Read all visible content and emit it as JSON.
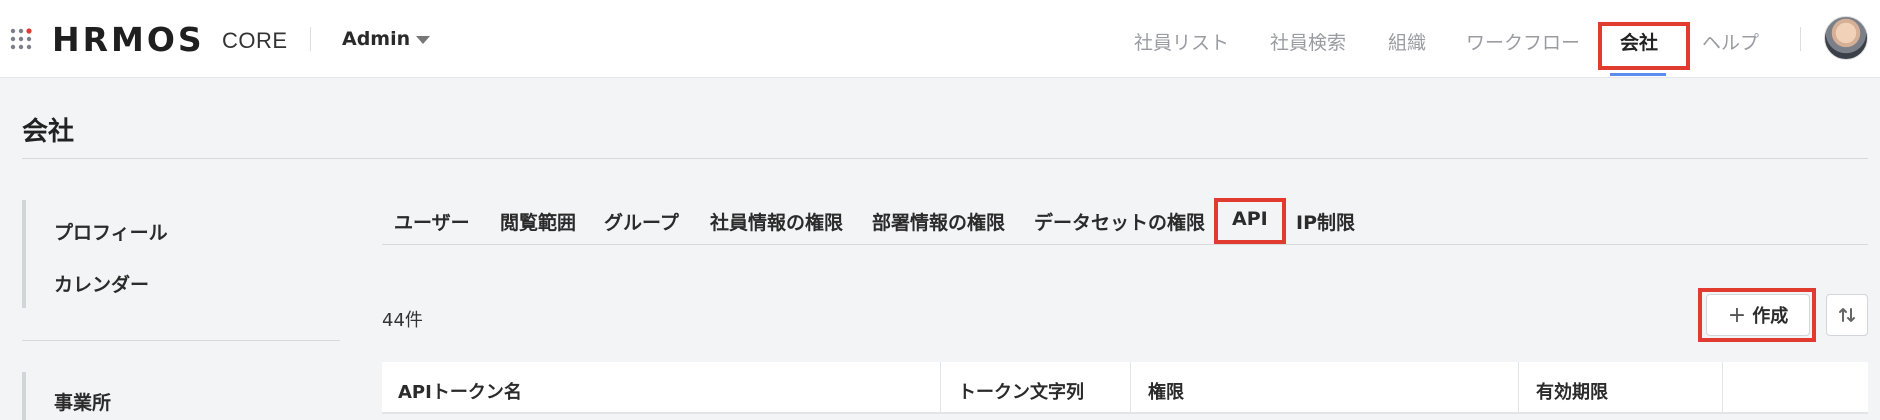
{
  "header": {
    "logo_text": "HRMOS",
    "logo_sub": "CORE",
    "account_label": "Admin",
    "nav": [
      {
        "label": "社員リスト"
      },
      {
        "label": "社員検索"
      },
      {
        "label": "組織"
      },
      {
        "label": "ワークフロー"
      },
      {
        "label": "会社",
        "active": true
      },
      {
        "label": "ヘルプ"
      }
    ]
  },
  "page": {
    "title": "会社"
  },
  "sidebar": {
    "group1": [
      {
        "label": "プロフィール"
      },
      {
        "label": "カレンダー"
      }
    ],
    "group2": [
      {
        "label": "事業所"
      }
    ]
  },
  "tabs": [
    {
      "label": "ユーザー"
    },
    {
      "label": "閲覧範囲"
    },
    {
      "label": "グループ"
    },
    {
      "label": "社員情報の権限"
    },
    {
      "label": "部署情報の権限"
    },
    {
      "label": "データセットの権限"
    },
    {
      "label": "API",
      "active": true
    },
    {
      "label": "IP制限"
    }
  ],
  "toolbar": {
    "count_text": "44件",
    "create_label": "作成",
    "create_icon": "plus-icon",
    "sort_icon": "sort-icon"
  },
  "table": {
    "columns": [
      "APIトークン名",
      "トークン文字列",
      "権限",
      "有効期限",
      ""
    ]
  },
  "colors": {
    "highlight": "#e03b2e",
    "nav_active_underline": "#5b8def",
    "brand_dot": "#e03b2e"
  }
}
